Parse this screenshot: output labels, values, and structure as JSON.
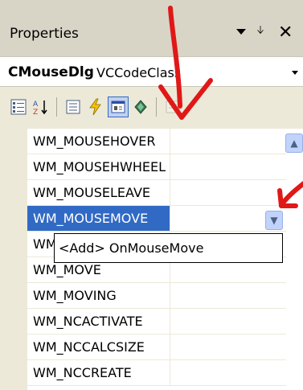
{
  "panel": {
    "title": "Properties",
    "dropdown_icon": "triangle-down",
    "pin_icon": "pin",
    "close_icon": "close-x"
  },
  "object_selector": {
    "name": "CMouseDlg",
    "type": "VCCodeClass"
  },
  "toolbar": {
    "buttons": [
      {
        "icon": "categorized-icon"
      },
      {
        "icon": "alphabetical-icon"
      },
      {
        "icon": "properties-icon"
      },
      {
        "icon": "events-icon"
      },
      {
        "icon": "messages-icon",
        "active": true
      },
      {
        "icon": "overrides-icon"
      },
      {
        "icon": "property-pages-icon",
        "disabled": true
      }
    ]
  },
  "grid": {
    "rows": [
      {
        "name": "WM_MOUSEHOVER"
      },
      {
        "name": "WM_MOUSEHWHEEL"
      },
      {
        "name": "WM_MOUSELEAVE"
      },
      {
        "name": "WM_MOUSEMOVE",
        "selected": true
      },
      {
        "name": "WM_MOVE"
      },
      {
        "name": "WM_MOVE"
      },
      {
        "name": "WM_MOVING"
      },
      {
        "name": "WM_NCACTIVATE"
      },
      {
        "name": "WM_NCCALCSIZE"
      },
      {
        "name": "WM_NCCREATE"
      }
    ],
    "popup_option": "<Add> OnMouseMove"
  },
  "colors": {
    "selection": "#316ac5",
    "toolbar_bg": "#ece9d8",
    "annotation": "#e01818"
  }
}
